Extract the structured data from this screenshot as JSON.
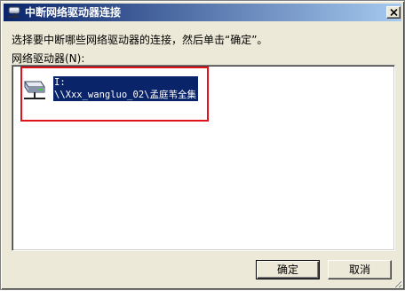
{
  "window": {
    "title": "中断网络驱动器连接",
    "instruction": "选择要中断哪些网络驱动器的连接，然后单击“确定”。",
    "list_label": "网络驱动器(N):"
  },
  "drives": [
    {
      "letter": "I:",
      "path": "\\\\Xxx_wangluo_02\\孟庭苇全集",
      "icon": "network-drive-icon",
      "selected": true
    }
  ],
  "buttons": {
    "ok": "确定",
    "cancel": "取消"
  },
  "colors": {
    "titlebar_start": "#0a246a",
    "titlebar_end": "#a6caf0",
    "selection": "#0a246a",
    "annotation_box": "#e0121a",
    "dialog_face": "#ece9d8"
  }
}
